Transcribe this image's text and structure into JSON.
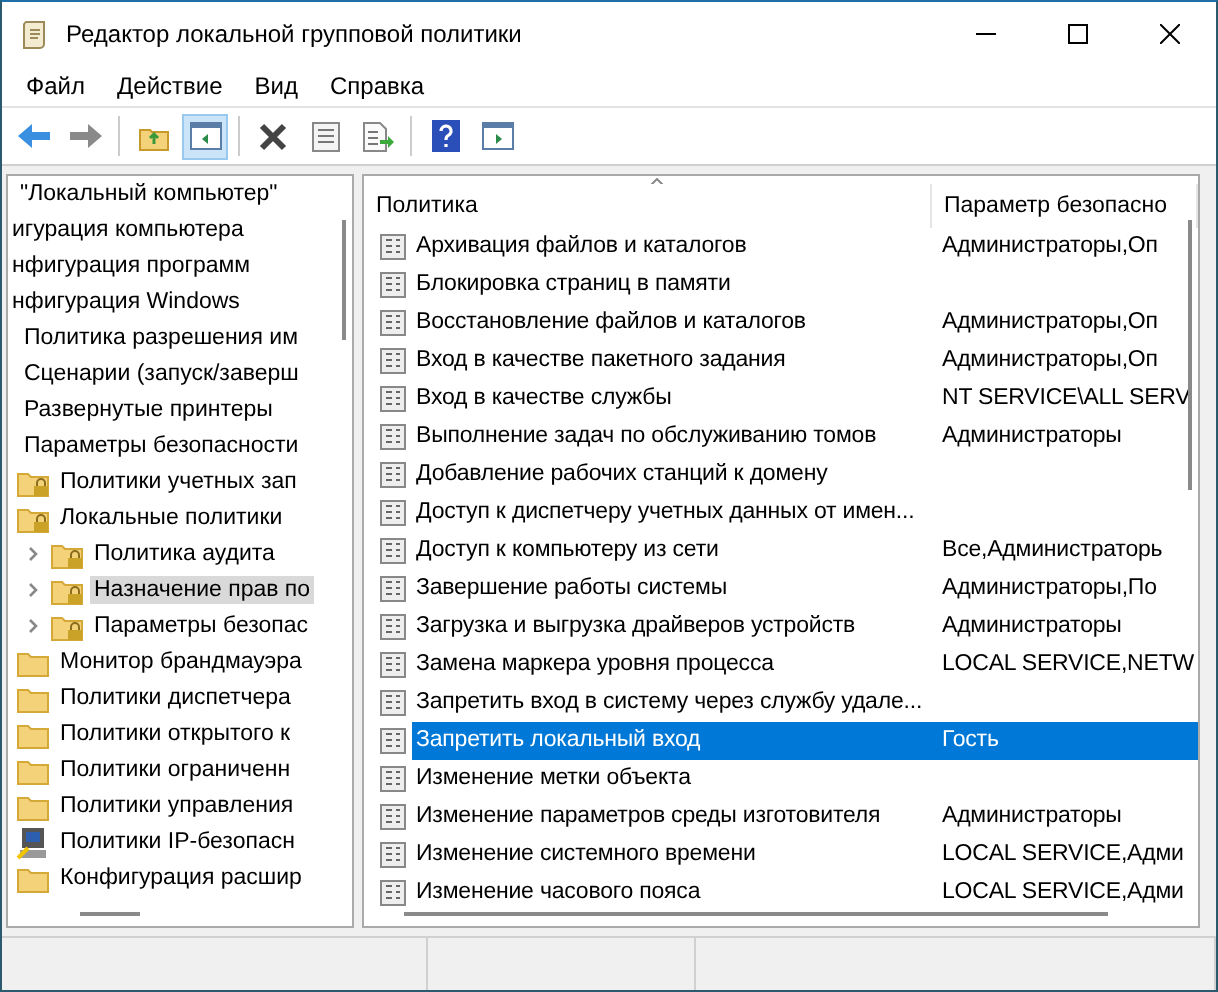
{
  "window": {
    "title": "Редактор локальной групповой политики"
  },
  "menu": [
    "Файл",
    "Действие",
    "Вид",
    "Справка"
  ],
  "tree": [
    {
      "label": "\"Локальный компьютер\"",
      "selected": false,
      "children": [
        {
          "label": "игурация компьютера",
          "selected": false,
          "children": [
            {
              "label": "нфигурация программ",
              "selected": false
            },
            {
              "label": "нфигурация Windows",
              "selected": false,
              "children": [
                {
                  "label": "Политика разрешения им",
                  "selected": false
                },
                {
                  "label": "Сценарии (запуск/заверш",
                  "selected": false
                },
                {
                  "label": "Развернутые принтеры",
                  "selected": false
                },
                {
                  "label": "Параметры безопасности",
                  "selected": false,
                  "children": [
                    {
                      "label": "Политики учетных зап",
                      "kind": "locked-folder",
                      "selected": false
                    },
                    {
                      "label": "Локальные политики",
                      "kind": "locked-folder",
                      "selected": false,
                      "children": [
                        {
                          "label": "Политика аудита",
                          "kind": "locked-folder",
                          "selected": false,
                          "expanded": false
                        },
                        {
                          "label": "Назначение прав по",
                          "kind": "locked-folder",
                          "selected": true,
                          "expanded": false
                        },
                        {
                          "label": "Параметры безопас",
                          "kind": "locked-folder",
                          "selected": false,
                          "expanded": false
                        }
                      ]
                    },
                    {
                      "label": "Монитор брандмауэра",
                      "kind": "folder",
                      "selected": false
                    },
                    {
                      "label": "Политики диспетчера",
                      "kind": "folder",
                      "selected": false
                    },
                    {
                      "label": "Политики открытого к",
                      "kind": "folder",
                      "selected": false
                    },
                    {
                      "label": "Политики ограниченн",
                      "kind": "folder",
                      "selected": false
                    },
                    {
                      "label": "Политики управления",
                      "kind": "folder",
                      "selected": false
                    },
                    {
                      "label": "Политики IP-безопасн",
                      "kind": "ip-security",
                      "selected": false
                    },
                    {
                      "label": "Конфигурация расшир",
                      "kind": "folder",
                      "selected": false
                    }
                  ]
                }
              ]
            }
          ]
        }
      ]
    }
  ],
  "table": {
    "columns": [
      "Политика",
      "Параметр безопасно"
    ],
    "rows": [
      {
        "policy": "Архивация файлов и каталогов",
        "setting": "Администраторы,Оп",
        "selected": false
      },
      {
        "policy": "Блокировка страниц в памяти",
        "selected": false
      },
      {
        "policy": "Восстановление файлов и каталогов",
        "setting": "Администраторы,Оп",
        "selected": false
      },
      {
        "policy": "Вход в качестве пакетного задания",
        "setting": "Администраторы,Оп",
        "selected": false
      },
      {
        "policy": "Вход в качестве службы",
        "setting": "NT SERVICE\\ALL SERV",
        "selected": false
      },
      {
        "policy": "Выполнение задач по обслуживанию томов",
        "setting": "Администраторы",
        "selected": false
      },
      {
        "policy": "Добавление рабочих станций к домену",
        "selected": false
      },
      {
        "policy": "Доступ к диспетчеру учетных данных от имен...",
        "selected": false
      },
      {
        "policy": "Доступ к компьютеру из сети",
        "setting": "Все,Администраторь",
        "selected": false
      },
      {
        "policy": "Завершение работы системы",
        "setting": "Администраторы,По",
        "selected": false
      },
      {
        "policy": "Загрузка и выгрузка драйверов устройств",
        "setting": "Администраторы",
        "selected": false
      },
      {
        "policy": "Замена маркера уровня процесса",
        "setting": "LOCAL SERVICE,NETW",
        "selected": false
      },
      {
        "policy": "Запретить вход в систему через службу удале...",
        "selected": false
      },
      {
        "policy": "Запретить локальный вход",
        "setting": "Гость",
        "selected": true
      },
      {
        "policy": "Изменение метки объекта",
        "selected": false
      },
      {
        "policy": "Изменение параметров среды изготовителя",
        "setting": "Администраторы",
        "selected": false
      },
      {
        "policy": "Изменение системного времени",
        "setting": "LOCAL SERVICE,Адми",
        "selected": false
      },
      {
        "policy": "Изменение часового пояса",
        "setting": "LOCAL SERVICE,Адми",
        "selected": false
      }
    ]
  }
}
